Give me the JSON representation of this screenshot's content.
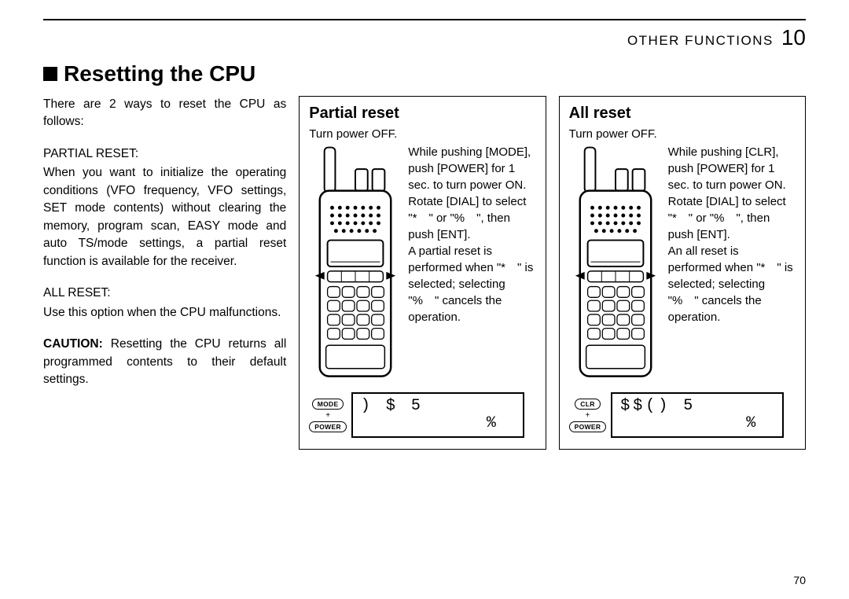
{
  "header": {
    "section": "OTHER FUNCTIONS",
    "chapter": "10"
  },
  "title": "Resetting the CPU",
  "intro": "There are 2 ways to reset the CPU as follows:",
  "partial_block": {
    "label": "PARTIAL RESET:",
    "text": "When you want to initialize the operating conditions (VFO frequency, VFO settings, SET mode contents) without clearing the memory, program scan, EASY mode and auto TS/mode settings, a partial reset function is available for the receiver."
  },
  "all_block": {
    "label": "ALL RESET:",
    "text": "Use this option when the CPU malfunctions."
  },
  "caution": {
    "label": "CAUTION:",
    "text": " Resetting the CPU returns all programmed contents to their default settings."
  },
  "panel_partial": {
    "heading": "Partial reset",
    "step1": "Turn power OFF.",
    "instr": "While pushing [MODE], push [POWER] for 1 sec. to turn power ON. Rotate [DIAL] to select \"* \" or \"% \", then push [ENT].\nA partial reset is performed when \"* \" is selected; selecting \"% \" cancels the operation.",
    "key_top": "MODE",
    "key_plus": "+",
    "key_bot": "POWER",
    "lcd_line1": ") $ 5",
    "lcd_line2": "%"
  },
  "panel_all": {
    "heading": "All reset",
    "step1": "Turn power OFF.",
    "instr": "While pushing [CLR], push [POWER] for 1 sec. to turn power ON. Rotate [DIAL] to select \"* \" or \"% \", then push [ENT].\nAn all reset is performed when \"* \" is selected; selecting \"% \" cancels the operation.",
    "key_top": "CLR",
    "key_plus": "+",
    "key_bot": "POWER",
    "lcd_line1": "$$()  5",
    "lcd_line2": "%"
  },
  "page_number": "70"
}
